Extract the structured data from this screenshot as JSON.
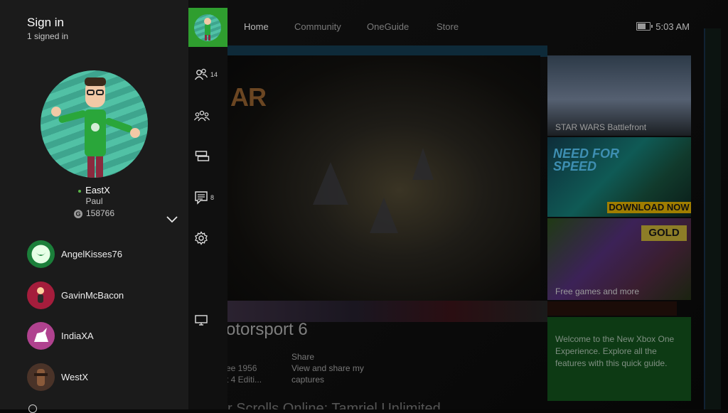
{
  "guide": {
    "title": "Sign in",
    "signed_in_count": "1 signed in",
    "profile": {
      "gamertag": "EastX",
      "real_name": "Paul",
      "gamerscore": "158766",
      "gamerscore_icon_glyph": "G",
      "presence_color": "#5ab648"
    },
    "friends": [
      {
        "name": "AngelKisses76",
        "avatar": "green-heart-avatar"
      },
      {
        "name": "GavinMcBacon",
        "avatar": "red-figure-avatar"
      },
      {
        "name": "IndiaXA",
        "avatar": "pink-unicorn-avatar"
      },
      {
        "name": "WestX",
        "avatar": "warrior-avatar"
      }
    ]
  },
  "rail": {
    "friends_count": "14",
    "messages_count": "8",
    "accent": "#2f9e2f"
  },
  "dashboard": {
    "nav": [
      "Home",
      "Community",
      "OneGuide",
      "Store"
    ],
    "time": "5:03 AM",
    "hero_title_fragment": "AR",
    "game_title": "otorsport 6",
    "game_sub_1": "ee 1956",
    "game_sub_2": "t 4 Editi...",
    "share_label": "Share",
    "share_desc": "View and share my captures",
    "bottom_text": "r Scrolls Online: Tamriel Unlimited",
    "tiles": {
      "star_wars": "STAR WARS Battlefront",
      "nfs_logo_line1": "NEED FOR",
      "nfs_logo_line2": "SPEED",
      "nfs_banner": "DOWNLOAD NOW",
      "gold_badge": "GOLD",
      "gold_caption": "Free games and more",
      "welcome": "Welcome to the New Xbox One Experience. Explore all the features with this quick guide."
    }
  }
}
